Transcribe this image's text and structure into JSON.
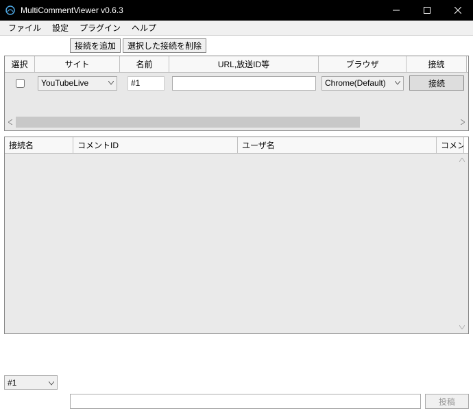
{
  "window": {
    "title": "MultiCommentViewer v0.6.3"
  },
  "menu": {
    "file": "ファイル",
    "settings": "設定",
    "plugin": "プラグイン",
    "help": "ヘルプ"
  },
  "toolbar": {
    "add_connection": "接続を追加",
    "delete_selected": "選択した接続を削除"
  },
  "connections": {
    "headers": {
      "select": "選択",
      "site": "サイト",
      "name": "名前",
      "url": "URL,放送ID等",
      "browser": "ブラウザ",
      "connect": "接続"
    },
    "rows": [
      {
        "checked": false,
        "site": "YouTubeLive",
        "name": "#1",
        "url": "",
        "browser": "Chrome(Default)",
        "connect_label": "接続"
      }
    ]
  },
  "comments": {
    "headers": {
      "connection_name": "接続名",
      "comment_id": "コメントID",
      "user_name": "ユーザ名",
      "comment": "コメン"
    }
  },
  "post": {
    "target": "#1",
    "button": "投稿"
  }
}
